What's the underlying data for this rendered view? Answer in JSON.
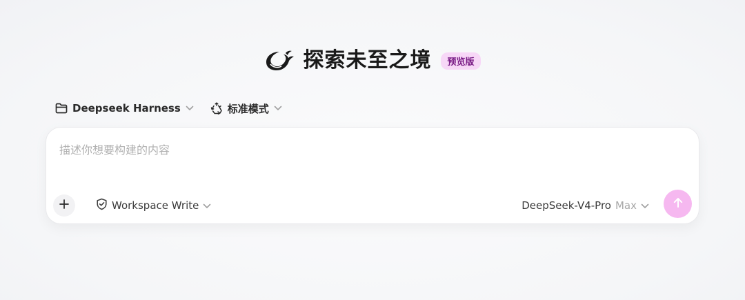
{
  "hero": {
    "title": "探索未至之境",
    "badge": "预览版",
    "logo_icon": "deepseek-whale-icon"
  },
  "controls": {
    "project": {
      "label": "Deepseek Harness",
      "icon": "folder-icon"
    },
    "mode": {
      "label": "标准模式",
      "icon": "recycle-icon"
    }
  },
  "composer": {
    "placeholder": "描述你想要构建的内容",
    "value": "",
    "permission": {
      "label": "Workspace Write",
      "icon": "shield-check-icon"
    },
    "model": {
      "name": "DeepSeek-V4-Pro",
      "effort": "Max"
    },
    "send_icon": "arrow-up-icon",
    "attach_icon": "plus-icon"
  },
  "colors": {
    "badge_bg": "#f7d7f7",
    "badge_text": "#7a1c86",
    "send_button": "#f6b8f0",
    "logo": "#1a1a1a"
  }
}
